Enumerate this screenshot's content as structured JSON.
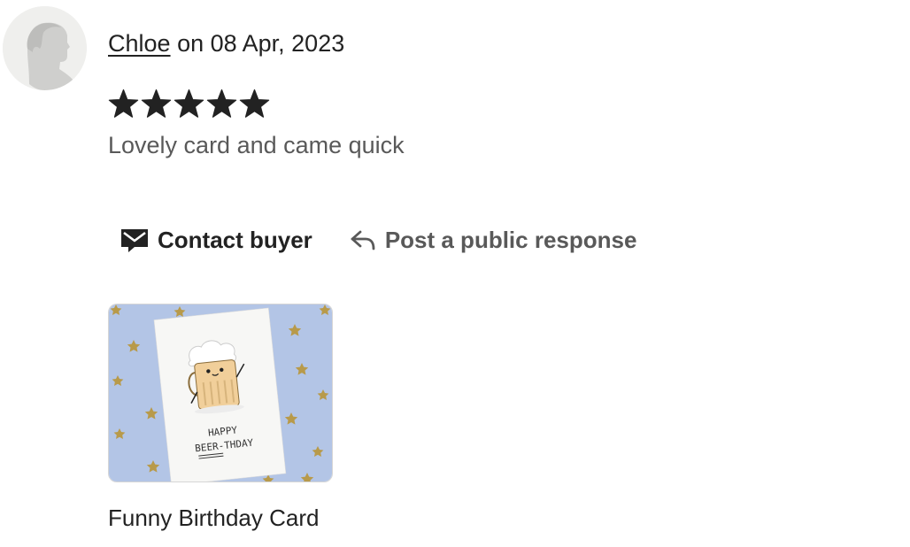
{
  "review": {
    "author": "Chloe",
    "date_text": "on 08 Apr, 2023",
    "rating": 5,
    "max_rating": 5,
    "text": "Lovely card and came quick"
  },
  "actions": {
    "contact_label": "Contact buyer",
    "respond_label": "Post a public response"
  },
  "product": {
    "title": "Funny Birthday Card",
    "card_line1": "HAPPY",
    "card_line2": "BEER-THDAY"
  },
  "colors": {
    "text": "#222222",
    "muted_text": "#595959",
    "thumb_background": "#b3c5e6",
    "star": "#222222"
  },
  "icons": {
    "contact": "envelope-icon",
    "respond": "reply-arrow-icon",
    "avatar": "default-avatar-icon",
    "rating": "star-icon"
  }
}
